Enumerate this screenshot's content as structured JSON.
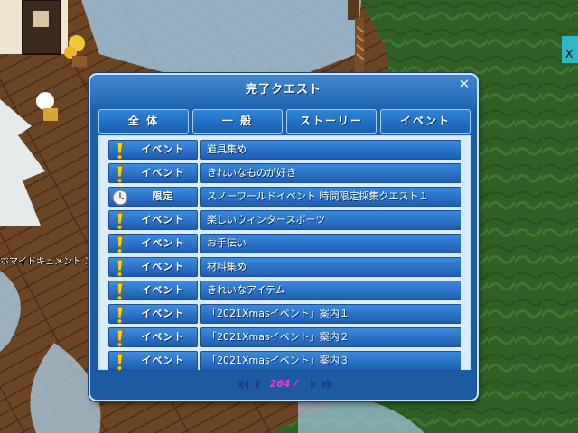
{
  "window": {
    "title": "完了クエスト",
    "close_icon": "close-icon"
  },
  "tabs": [
    {
      "label": "全 体"
    },
    {
      "label": "一 般"
    },
    {
      "label": "ストーリー"
    },
    {
      "label": "イベント"
    }
  ],
  "quests": [
    {
      "badge": "イベント",
      "icon": "exclamation-icon",
      "name": "道具集め"
    },
    {
      "badge": "イベント",
      "icon": "exclamation-icon",
      "name": "きれいなものが好き"
    },
    {
      "badge": "限定",
      "icon": "clock-icon",
      "name": "スノーワールドイベント 時間限定採集クエスト１"
    },
    {
      "badge": "イベント",
      "icon": "exclamation-icon",
      "name": "楽しいウィンタースポーツ"
    },
    {
      "badge": "イベント",
      "icon": "exclamation-icon",
      "name": "お手伝い"
    },
    {
      "badge": "イベント",
      "icon": "exclamation-icon",
      "name": "材料集め"
    },
    {
      "badge": "イベント",
      "icon": "exclamation-icon",
      "name": "きれいなアイテム"
    },
    {
      "badge": "イベント",
      "icon": "exclamation-icon",
      "name": "「2021Xmasイベント」案内１"
    },
    {
      "badge": "イベント",
      "icon": "exclamation-icon",
      "name": "「2021Xmasイベント」案内２"
    },
    {
      "badge": "イベント",
      "icon": "exclamation-icon",
      "name": "「2021Xmasイベント」案内３"
    }
  ],
  "pager": {
    "page": "264 /"
  },
  "background": {
    "caption": "ホマイドキュメント ＞ MIL"
  },
  "colors": {
    "window_blue": "#1f5fa8",
    "panel_bg": "#d8ecfb",
    "page_number": "#e53bd8",
    "exclamation": "#f6d21c"
  }
}
